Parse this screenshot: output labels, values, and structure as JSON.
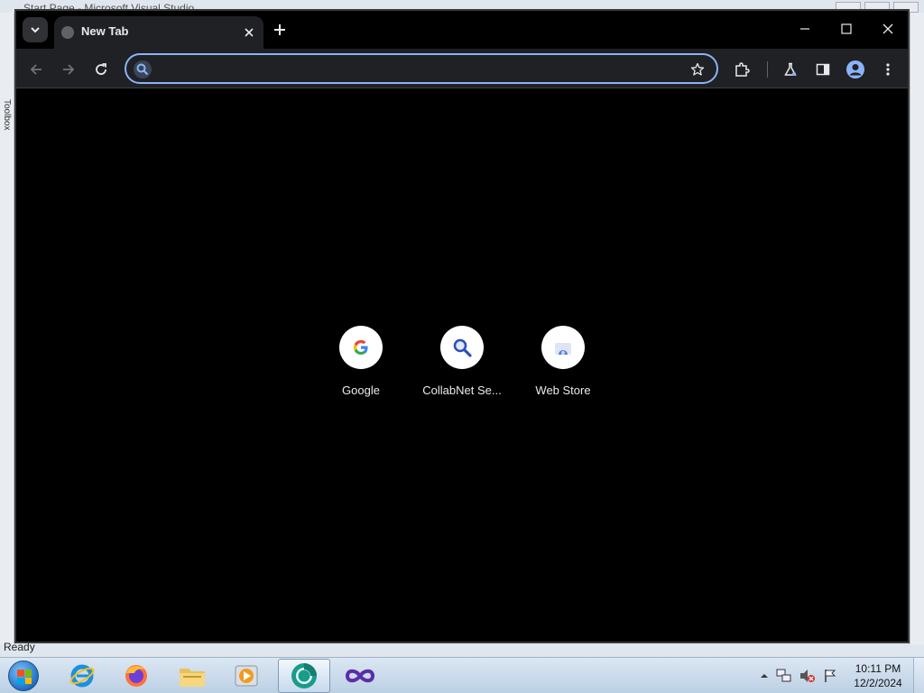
{
  "background_app": {
    "title": "Start Page - Microsoft Visual Studio",
    "side_label": "Toolbox",
    "status": "Ready"
  },
  "browser": {
    "tab": {
      "title": "New Tab"
    },
    "omnibox": {
      "value": "",
      "placeholder": ""
    },
    "accent_color": "#8ab4f8",
    "shortcuts": [
      {
        "label": "Google",
        "icon": "google-g-icon"
      },
      {
        "label": "CollabNet Se...",
        "icon": "collabnet-search-icon"
      },
      {
        "label": "Web Store",
        "icon": "web-store-icon"
      }
    ]
  },
  "taskbar": {
    "items": [
      {
        "name": "internet-explorer",
        "icon": "ie-icon"
      },
      {
        "name": "firefox",
        "icon": "firefox-icon"
      },
      {
        "name": "file-explorer",
        "icon": "folder-icon"
      },
      {
        "name": "media-player",
        "icon": "media-player-icon"
      },
      {
        "name": "browser",
        "icon": "chrome-beta-icon",
        "active": true
      },
      {
        "name": "visual-studio",
        "icon": "visual-studio-icon"
      }
    ],
    "clock": {
      "time": "10:11 PM",
      "date": "12/2/2024"
    }
  }
}
